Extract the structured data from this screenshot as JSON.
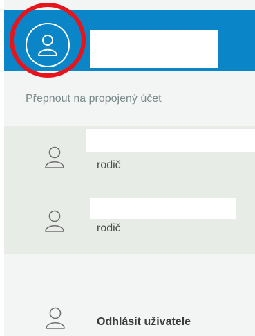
{
  "colors": {
    "header_bg": "#0a85c7",
    "highlight": "#e8141b",
    "panel_bg": "#f3f5f5",
    "accounts_bg": "#e7ece7"
  },
  "header": {
    "avatar_icon": "user-icon",
    "user_name": ""
  },
  "switch_label": "Přepnout na propojený účet",
  "linked_accounts": [
    {
      "name": "",
      "role": "rodič",
      "icon": "user-icon"
    },
    {
      "name": "",
      "role": "rodič",
      "icon": "user-icon"
    }
  ],
  "logout": {
    "label": "Odhlásit uživatele",
    "icon": "user-icon"
  }
}
